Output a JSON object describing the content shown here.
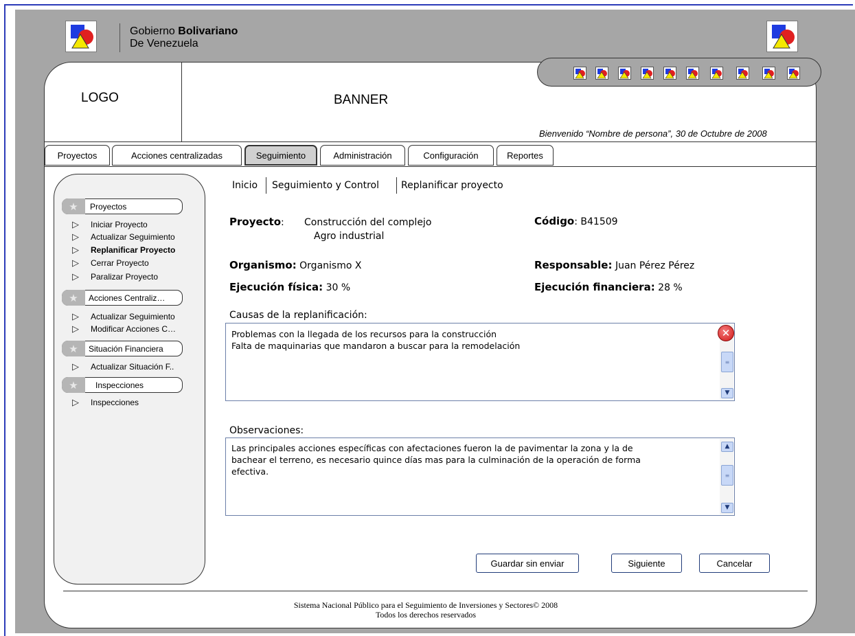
{
  "header": {
    "gov_line1_prefix": "Gobierno ",
    "gov_line1_bold": "Bolivariano",
    "gov_line2": "De Venezuela"
  },
  "banner": {
    "logo_label": "LOGO",
    "banner_label": "BANNER",
    "welcome": "Bienvenido “Nombre de persona”, 30 de Octubre de 2008"
  },
  "tabs": [
    {
      "label": "Proyectos"
    },
    {
      "label": "Acciones centralizadas"
    },
    {
      "label": "Seguimiento",
      "active": true
    },
    {
      "label": "Administración"
    },
    {
      "label": "Configuración"
    },
    {
      "label": "Reportes"
    }
  ],
  "sidebar": {
    "sections": [
      {
        "label": "Proyectos",
        "items": [
          "Iniciar Proyecto",
          "Actualizar Seguimiento",
          "Replanificar Proyecto",
          "Cerrar Proyecto",
          "Paralizar Proyecto"
        ]
      },
      {
        "label": "Acciones Centraliz…",
        "items": [
          "Actualizar Seguimiento",
          "Modificar Acciones C…"
        ]
      },
      {
        "label": "Situación Financiera",
        "items": [
          "Actualizar Situación F.."
        ]
      },
      {
        "label": "Inspecciones",
        "items": [
          "Inspecciones"
        ]
      }
    ]
  },
  "breadcrumb": [
    "Inicio",
    "Seguimiento y Control",
    "Replanificar proyecto"
  ],
  "project": {
    "proyecto_label": "Proyecto",
    "proyecto_value_1": "Construcción del complejo",
    "proyecto_value_2": "Agro industrial",
    "codigo_label": "Código",
    "codigo_value": "B41509",
    "organismo_label": "Organismo:",
    "organismo_value": "Organismo X",
    "responsable_label": "Responsable:",
    "responsable_value": "Juan Pérez Pérez",
    "ejec_fisica_label": "Ejecución física:",
    "ejec_fisica_value": "30 %",
    "ejec_financiera_label": "Ejecución financiera:",
    "ejec_financiera_value": "28 %"
  },
  "causas": {
    "label": "Causas de la replanificación:",
    "line1": "Problemas con la llegada de los recursos para la construcción",
    "line2": "Falta de maquinarias que mandaron a buscar para la remodelación"
  },
  "observaciones": {
    "label": "Observaciones:",
    "line1": "Las principales acciones específicas con afectaciones fueron la de pavimentar la zona y la de",
    "line2": "bachear el terreno, es necesario quince días mas para la culminación de la operación de forma",
    "line3": "efectiva."
  },
  "buttons": {
    "save": "Guardar sin enviar",
    "next": "Siguiente",
    "cancel": "Cancelar"
  },
  "footer": {
    "line1": "Sistema Nacional Público para el Seguimiento de Inversiones y Sectores© 2008",
    "line2": "Todos los derechos reservados"
  },
  "colors": {
    "frame_border": "#2b3bb8",
    "background": "#a6a6a6",
    "icon_blue": "#1e3be0",
    "icon_red": "#e02020",
    "icon_yellow": "#f5e800"
  },
  "icons": [
    "shapes-icon",
    "star-icon",
    "triangle-bullet-icon",
    "close-icon",
    "scroll-up-icon",
    "scroll-down-icon"
  ]
}
